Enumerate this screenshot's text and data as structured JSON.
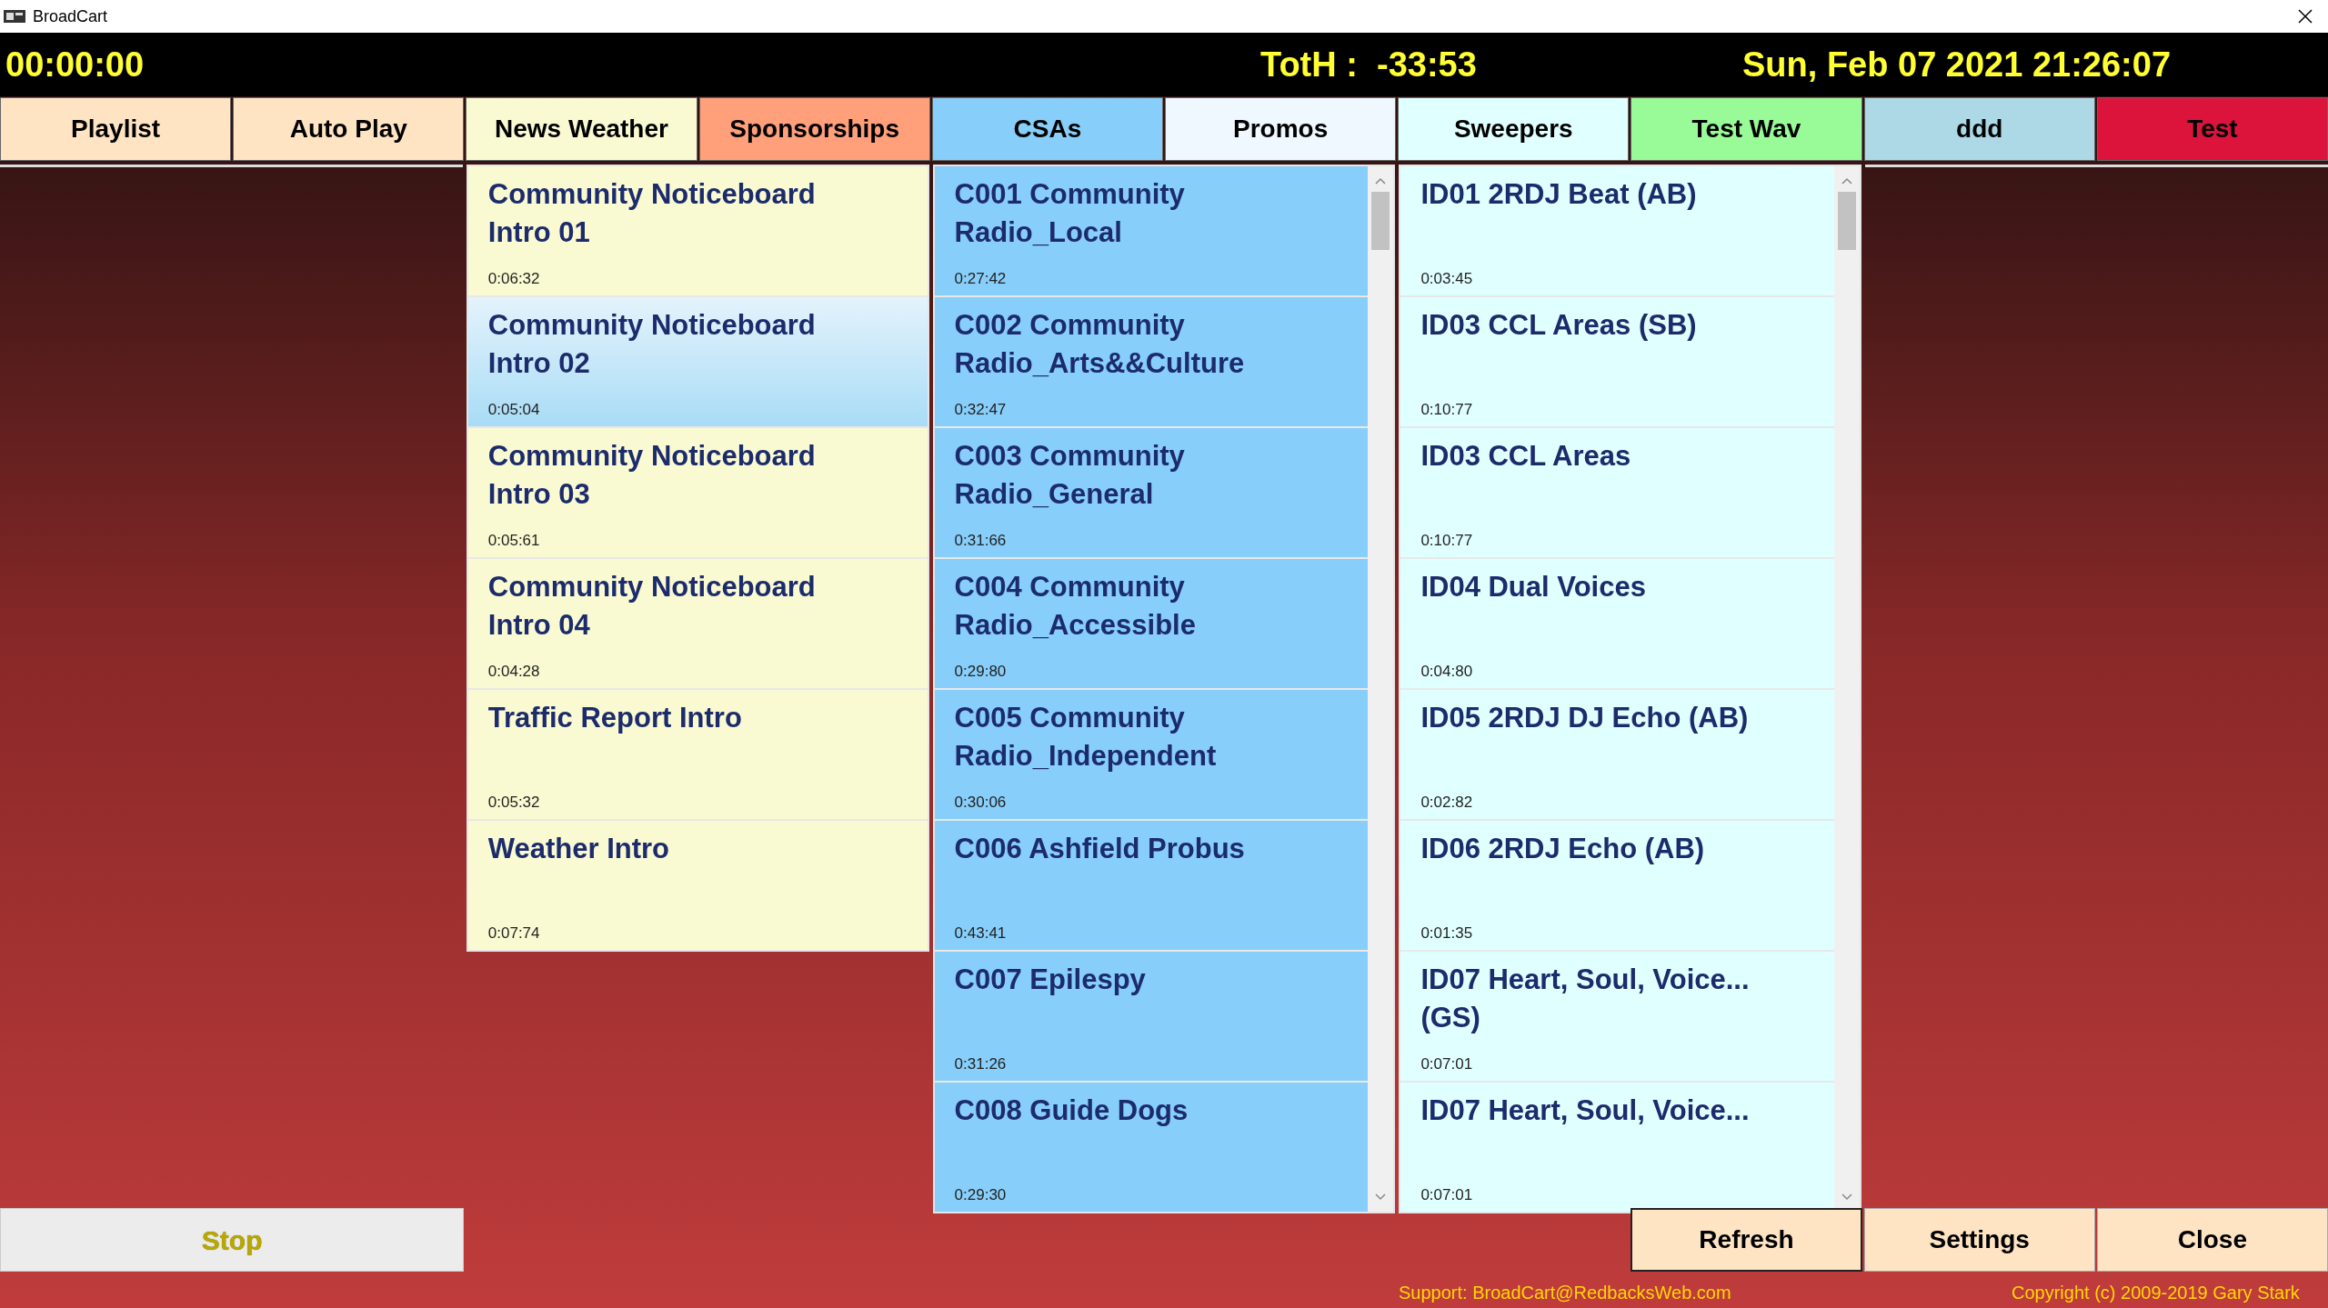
{
  "window": {
    "title": "BroadCart"
  },
  "header": {
    "elapsed": "00:00:00",
    "toth": "TotH :  -33:53",
    "datetime": "Sun, Feb 07 2021 21:26:07"
  },
  "tabs": [
    {
      "label": "Playlist",
      "color": "#ffe4c4"
    },
    {
      "label": "Auto Play",
      "color": "#ffe4c4"
    },
    {
      "label": "News Weather",
      "color": "#fafad2"
    },
    {
      "label": "Sponsorships",
      "color": "#ffa07a"
    },
    {
      "label": "CSAs",
      "color": "#87cefa"
    },
    {
      "label": "Promos",
      "color": "#f0f8ff"
    },
    {
      "label": "Sweepers",
      "color": "#e0ffff"
    },
    {
      "label": "Test Wav",
      "color": "#98fb98"
    },
    {
      "label": "ddd",
      "color": "#add8e6"
    },
    {
      "label": "Test",
      "color": "#dc143c"
    }
  ],
  "panels": [
    {
      "color": "#fafad2",
      "scrollable": false,
      "items": [
        {
          "title": "Community Noticeboard Intro 01",
          "duration": "0:06:32",
          "selected": false
        },
        {
          "title": "Community Noticeboard Intro 02",
          "duration": "0:05:04",
          "selected": true
        },
        {
          "title": "Community Noticeboard Intro 03",
          "duration": "0:05:61",
          "selected": false
        },
        {
          "title": "Community Noticeboard Intro 04",
          "duration": "0:04:28",
          "selected": false
        },
        {
          "title": "Traffic Report Intro",
          "duration": "0:05:32",
          "selected": false
        },
        {
          "title": "Weather Intro",
          "duration": "0:07:74",
          "selected": false
        }
      ]
    },
    {
      "color": "#87cefa",
      "scrollable": true,
      "items": [
        {
          "title": "C001 Community Radio_Local",
          "duration": "0:27:42",
          "selected": false
        },
        {
          "title": "C002 Community Radio_Arts&&Culture",
          "duration": "0:32:47",
          "selected": false
        },
        {
          "title": "C003 Community Radio_General",
          "duration": "0:31:66",
          "selected": false
        },
        {
          "title": "C004 Community Radio_Accessible",
          "duration": "0:29:80",
          "selected": false
        },
        {
          "title": "C005 Community Radio_Independent",
          "duration": "0:30:06",
          "selected": false
        },
        {
          "title": "C006 Ashfield Probus",
          "duration": "0:43:41",
          "selected": false
        },
        {
          "title": "C007 Epilespy",
          "duration": "0:31:26",
          "selected": false
        },
        {
          "title": "C008 Guide Dogs",
          "duration": "0:29:30",
          "selected": false
        }
      ]
    },
    {
      "color": "#e0ffff",
      "scrollable": true,
      "items": [
        {
          "title": "ID01 2RDJ Beat (AB)",
          "duration": "0:03:45",
          "selected": false
        },
        {
          "title": "ID03 CCL Areas (SB)",
          "duration": "0:10:77",
          "selected": false
        },
        {
          "title": "ID03 CCL Areas",
          "duration": "0:10:77",
          "selected": false
        },
        {
          "title": "ID04 Dual Voices",
          "duration": "0:04:80",
          "selected": false
        },
        {
          "title": "ID05 2RDJ DJ Echo (AB)",
          "duration": "0:02:82",
          "selected": false
        },
        {
          "title": "ID06 2RDJ Echo (AB)",
          "duration": "0:01:35",
          "selected": false
        },
        {
          "title": "ID07 Heart, Soul, Voice... (GS)",
          "duration": "0:07:01",
          "selected": false
        },
        {
          "title": "ID07 Heart, Soul, Voice...",
          "duration": "0:07:01",
          "selected": false
        }
      ]
    }
  ],
  "stop_button": {
    "label": "Stop",
    "disabled": true
  },
  "buttons": [
    {
      "label": "Refresh",
      "focused": true
    },
    {
      "label": "Settings",
      "focused": false
    },
    {
      "label": "Close",
      "focused": false
    }
  ],
  "footer": {
    "support": "Support: BroadCart@RedbacksWeb.com",
    "copyright": "Copyright (c) 2009-2019 Gary Stark"
  }
}
